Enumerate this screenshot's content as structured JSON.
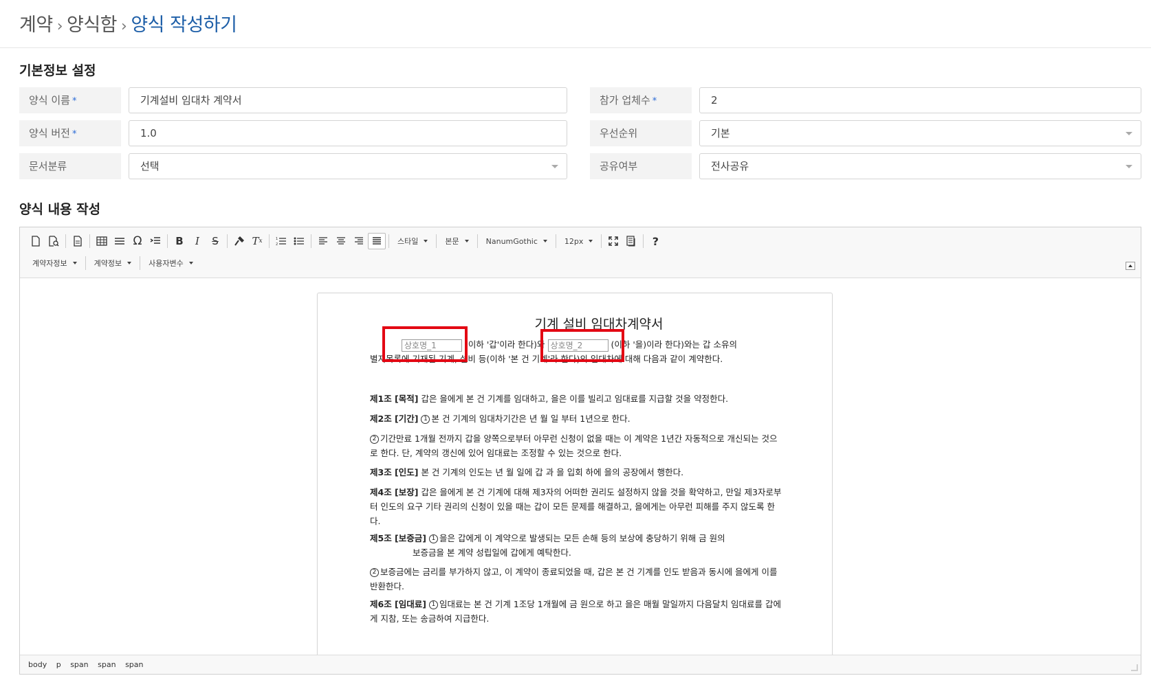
{
  "breadcrumb": {
    "level1": "계약",
    "level2": "양식함",
    "current": "양식 작성하기",
    "separator": "›"
  },
  "basic_info": {
    "title": "기본정보 설정",
    "form_name": {
      "label": "양식 이름",
      "value": "기계설비 임대차 계약서",
      "required": true
    },
    "participants": {
      "label": "참가 업체수",
      "value": "2",
      "required": true
    },
    "form_version": {
      "label": "양식 버전",
      "value": "1.0",
      "required": true
    },
    "priority": {
      "label": "우선순위",
      "value": "기본"
    },
    "doc_category": {
      "label": "문서분류",
      "value": "선택"
    },
    "sharing": {
      "label": "공유여부",
      "value": "전사공유"
    },
    "required_mark": "*"
  },
  "content_section": {
    "title": "양식 내용 작성"
  },
  "toolbar": {
    "style_combo": "스타일",
    "format_combo": "본문",
    "font_combo": "NanumGothic",
    "size_combo": "12px",
    "contractor_info": "계약자정보",
    "contract_info": "계약정보",
    "user_vars": "사용자변수"
  },
  "document": {
    "title": "기계 설비 임대차계약서",
    "var1": "상호명_1",
    "var2": "상호명_2",
    "intro_a": " (이하 '갑'이라 한다)와 ",
    "intro_b": " (이하 '을)이라 한다)와는 갑 소유의",
    "intro_c": "별지목록에 기재된 기계, 설비 등(이하 '본 건 기계'라 한다)의 임대차에 대해 다음과 같이 계약한다.",
    "a1_head": "제1조 [목적]",
    "a1_text": " 갑은 을에게 본 건 기계를 임대하고, 을은 이를 빌리고 임대료를 지급할 것을 약정한다.",
    "a2_head": "제2조 [기간]",
    "a2_text": "본 건 기계의 임대차기간은     년    월     일 부터 1년으로 한다.",
    "a2_p2": "기간만료 1개월 전까지 갑을 양쪽으로부터 아무런 신청이 없을 때는 이 계약은 1년간 자동적으로 개신되는 것으로 한다. 단, 계약의 갱신에 있어 임대료는 조정할 수 있는 것으로 한다.",
    "a3_head": "제3조 [인도]",
    "a3_text": " 본 건 기계의 인도는      년    월    일에 갑 과 을 입회 하에 을의 공장에서 행한다.",
    "a4_head": "제4조 [보장]",
    "a4_text": " 갑은 을에게 본 건 기계에 대해 제3자의 어떠한 권리도 설정하지 않을 것을 확약하고, 만일 제3자로부터 인도의 요구 기타 권리의 신청이 있을 때는 갑이 모든 문제를 해결하고, 을에게는 아무런 피해를 주지 않도록 한다.",
    "a5_head": "제5조 [보증금]",
    "a5_text": "을은 갑에게 이 계약으로 발생되는 모든 손해 등의 보상에 충당하기 위해 금 원의",
    "a5_text2": "보증금을 본 계약 성립일에 갑에게 예탁한다.",
    "a5_p2": "보증금에는 금리를 부가하지 않고, 이 계약이 종료되었을 때, 갑은 본 건 기계를 인도 받음과 동시에 을에게 이를 반환한다.",
    "a6_head": "제6조 [임대료]",
    "a6_text": "임대료는 본 건 기계 1조당 1개월에 금       원으로 하고 을은 매월 말일까지 다음달치 임대료를 갑에게 지참, 또는 송금하여 지급한다.",
    "circ1": "1",
    "circ2": "2"
  },
  "statusbar": {
    "p1": "body",
    "p2": "p",
    "p3": "span",
    "p4": "span",
    "p5": "span"
  }
}
